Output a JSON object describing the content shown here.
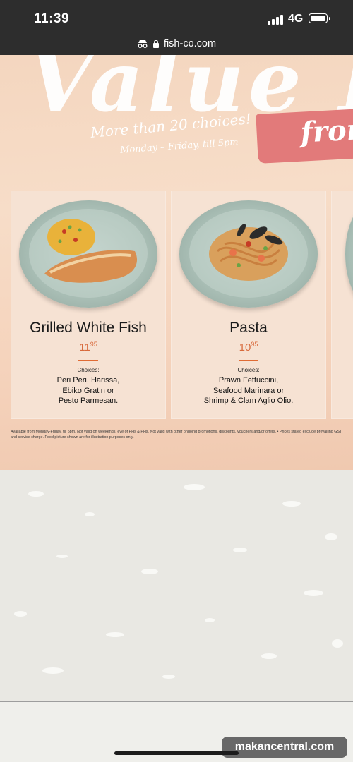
{
  "status_bar": {
    "time": "11:39",
    "network": "4G",
    "signal_icon": "signal-bars-icon",
    "battery_icon": "battery-icon"
  },
  "browser": {
    "url": "fish-co.com",
    "incognito_icon": "incognito-icon",
    "lock_icon": "lock-icon"
  },
  "menu": {
    "title": "Value Lu",
    "subtitle": "More than 20 choices!",
    "hours": "Monday – Friday, till 5pm",
    "price_prefix": "from",
    "items": [
      {
        "name": "Grilled White Fish",
        "price_main": "11",
        "price_cents": "95",
        "choices_label": "Choices:",
        "choices": "Peri Peri, Harissa,\nEbiko Gratin or\nPesto Parmesan."
      },
      {
        "name": "Pasta",
        "price_main": "10",
        "price_cents": "95",
        "choices_label": "Choices:",
        "choices": "Prawn Fettuccini,\nSeafood Marinara or\nShrimp & Clam Aglio Olio."
      }
    ],
    "fineprint": "Available from Monday-Friday, till 5pm. Not valid on weekends, eve of PHs & PHs. Not valid with other ongoing promotions, discounts, vouchers and/or offers. • Prices stated exclude prevailing GST and service charge. Food picture shown are for illustration purposes only."
  },
  "watermark": "makancentral.com",
  "colors": {
    "status_bar": "#2d2d2d",
    "banner": "#f5d6c0",
    "accent_price": "#d86a3c",
    "badge": "#e27a7a"
  }
}
